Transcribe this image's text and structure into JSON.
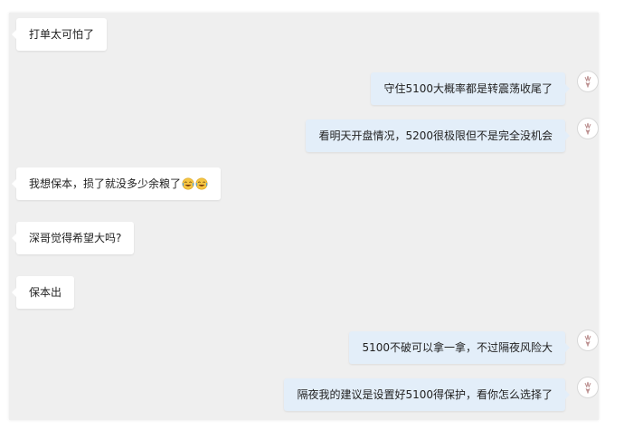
{
  "messages": [
    {
      "side": "in",
      "text": "打单太可怕了"
    },
    {
      "side": "out",
      "text": "守住5100大概率都是转震荡收尾了"
    },
    {
      "side": "out",
      "text": "看明天开盘情况，5200很极限但不是完全没机会"
    },
    {
      "side": "in",
      "text": "我想保本，损了就没多少余粮了",
      "emojis": [
        "laughing-crying-emoji",
        "laughing-crying-emoji"
      ]
    },
    {
      "side": "in",
      "text": "深哥觉得希望大吗?"
    },
    {
      "side": "in",
      "text": "保本出"
    },
    {
      "side": "out",
      "text": "5100不破可以拿一拿，不过隔夜风险大"
    },
    {
      "side": "out",
      "text": "隔夜我的建议是设置好5100得保护，看你怎么选择了"
    }
  ],
  "colors": {
    "background": "#efefef",
    "incoming_bubble": "#ffffff",
    "outgoing_bubble": "#e3eef9",
    "text": "#222222"
  }
}
